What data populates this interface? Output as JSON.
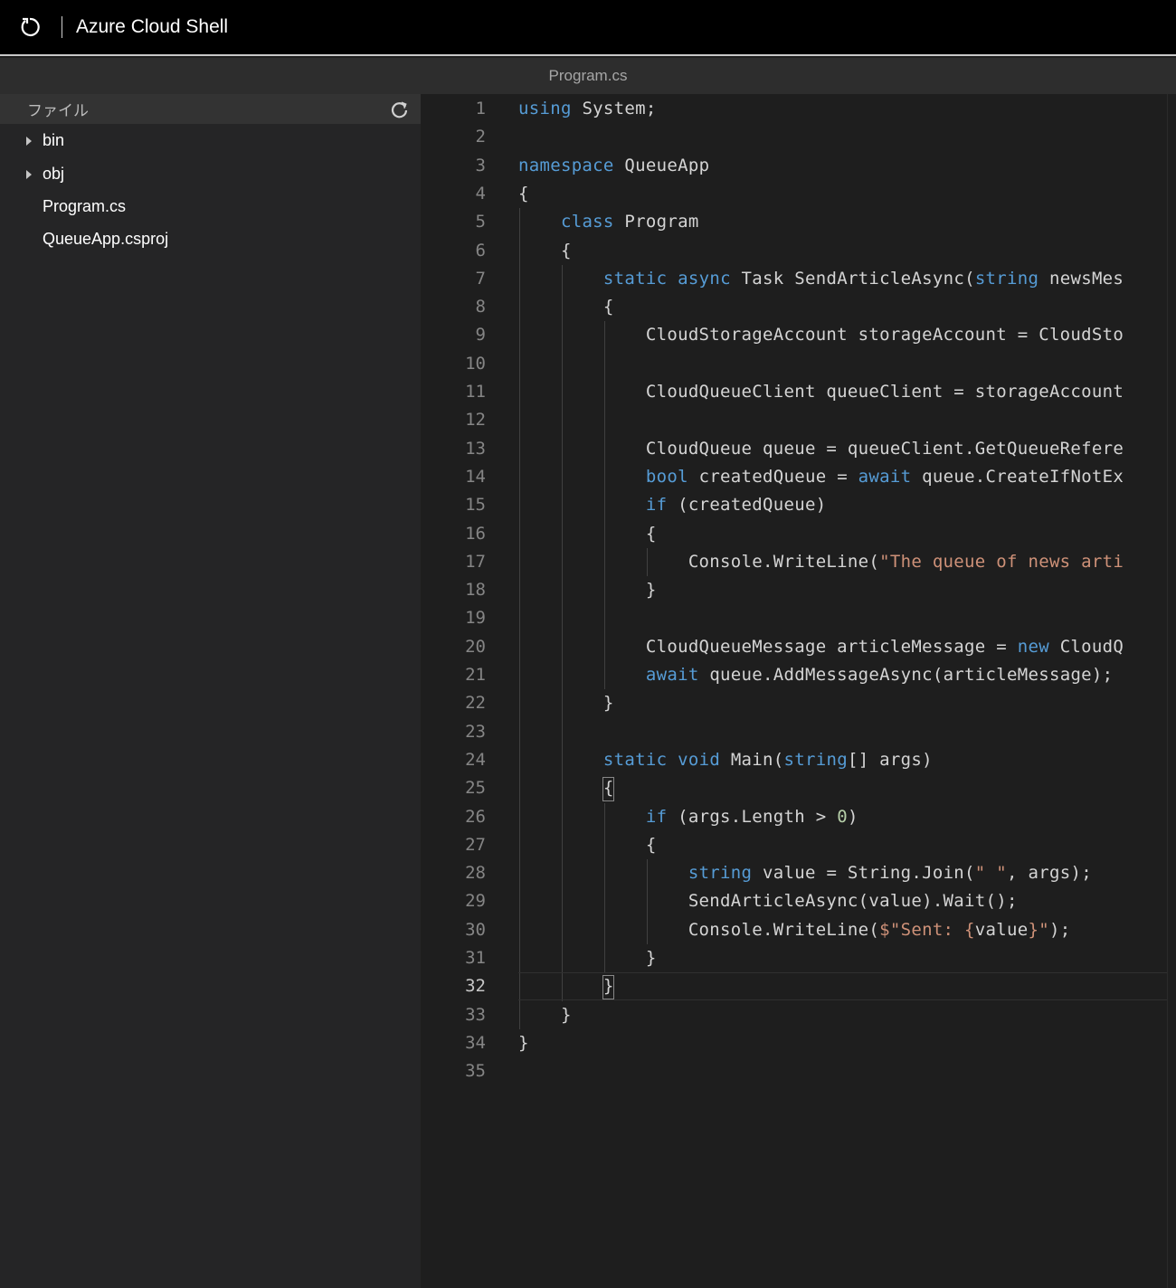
{
  "topbar": {
    "title": "Azure Cloud Shell",
    "icon": "restart-icon"
  },
  "tab": {
    "filename": "Program.cs"
  },
  "sidebar": {
    "header": "ファイル",
    "refresh_icon": "refresh-icon",
    "items": [
      {
        "label": "bin",
        "type": "folder",
        "expanded": false
      },
      {
        "label": "obj",
        "type": "folder",
        "expanded": false
      },
      {
        "label": "Program.cs",
        "type": "file"
      },
      {
        "label": "QueueApp.csproj",
        "type": "file"
      }
    ]
  },
  "editor": {
    "active_line": 32,
    "colors": {
      "keyword": "#569cd6",
      "string": "#ce9178",
      "number": "#b5cea8",
      "text": "#d4d4d4"
    },
    "lines": [
      [
        [
          "kw",
          "using"
        ],
        [
          "t",
          " System;"
        ]
      ],
      [],
      [
        [
          "kw",
          "namespace"
        ],
        [
          "t",
          " QueueApp"
        ]
      ],
      [
        [
          "t",
          "{"
        ]
      ],
      [
        [
          "t",
          "    "
        ],
        [
          "kw",
          "class"
        ],
        [
          "t",
          " Program"
        ]
      ],
      [
        [
          "t",
          "    {"
        ]
      ],
      [
        [
          "t",
          "        "
        ],
        [
          "kw",
          "static"
        ],
        [
          "t",
          " "
        ],
        [
          "kw",
          "async"
        ],
        [
          "t",
          " Task SendArticleAsync("
        ],
        [
          "kw",
          "string"
        ],
        [
          "t",
          " newsMes"
        ]
      ],
      [
        [
          "t",
          "        {"
        ]
      ],
      [
        [
          "t",
          "            CloudStorageAccount storageAccount = CloudSto"
        ]
      ],
      [],
      [
        [
          "t",
          "            CloudQueueClient queueClient = storageAccount"
        ]
      ],
      [],
      [
        [
          "t",
          "            CloudQueue queue = queueClient.GetQueueRefere"
        ]
      ],
      [
        [
          "t",
          "            "
        ],
        [
          "kw",
          "bool"
        ],
        [
          "t",
          " createdQueue = "
        ],
        [
          "kw",
          "await"
        ],
        [
          "t",
          " queue.CreateIfNotEx"
        ]
      ],
      [
        [
          "t",
          "            "
        ],
        [
          "kw",
          "if"
        ],
        [
          "t",
          " (createdQueue)"
        ]
      ],
      [
        [
          "t",
          "            {"
        ]
      ],
      [
        [
          "t",
          "                Console.WriteLine("
        ],
        [
          "str",
          "\"The queue of news arti"
        ]
      ],
      [
        [
          "t",
          "            }"
        ]
      ],
      [],
      [
        [
          "t",
          "            CloudQueueMessage articleMessage = "
        ],
        [
          "kw",
          "new"
        ],
        [
          "t",
          " CloudQ"
        ]
      ],
      [
        [
          "t",
          "            "
        ],
        [
          "kw",
          "await"
        ],
        [
          "t",
          " queue.AddMessageAsync(articleMessage);"
        ]
      ],
      [
        [
          "t",
          "        }"
        ]
      ],
      [],
      [
        [
          "t",
          "        "
        ],
        [
          "kw",
          "static"
        ],
        [
          "t",
          " "
        ],
        [
          "kw",
          "void"
        ],
        [
          "t",
          " Main("
        ],
        [
          "kw",
          "string"
        ],
        [
          "t",
          "[] args)"
        ]
      ],
      [
        [
          "t",
          "        {"
        ]
      ],
      [
        [
          "t",
          "            "
        ],
        [
          "kw",
          "if"
        ],
        [
          "t",
          " (args.Length > "
        ],
        [
          "num",
          "0"
        ],
        [
          "t",
          ")"
        ]
      ],
      [
        [
          "t",
          "            {"
        ]
      ],
      [
        [
          "t",
          "                "
        ],
        [
          "kw",
          "string"
        ],
        [
          "t",
          " value = String.Join("
        ],
        [
          "str",
          "\" \""
        ],
        [
          "t",
          ", args);"
        ]
      ],
      [
        [
          "t",
          "                SendArticleAsync(value).Wait();"
        ]
      ],
      [
        [
          "t",
          "                Console.WriteLine("
        ],
        [
          "str",
          "$\"Sent: {"
        ],
        [
          "t",
          "value"
        ],
        [
          "str",
          "}\""
        ],
        [
          "t",
          ");"
        ]
      ],
      [
        [
          "t",
          "            }"
        ]
      ],
      [
        [
          "t",
          "        }"
        ]
      ],
      [
        [
          "t",
          "    }"
        ]
      ],
      [
        [
          "t",
          "}"
        ]
      ],
      []
    ]
  }
}
